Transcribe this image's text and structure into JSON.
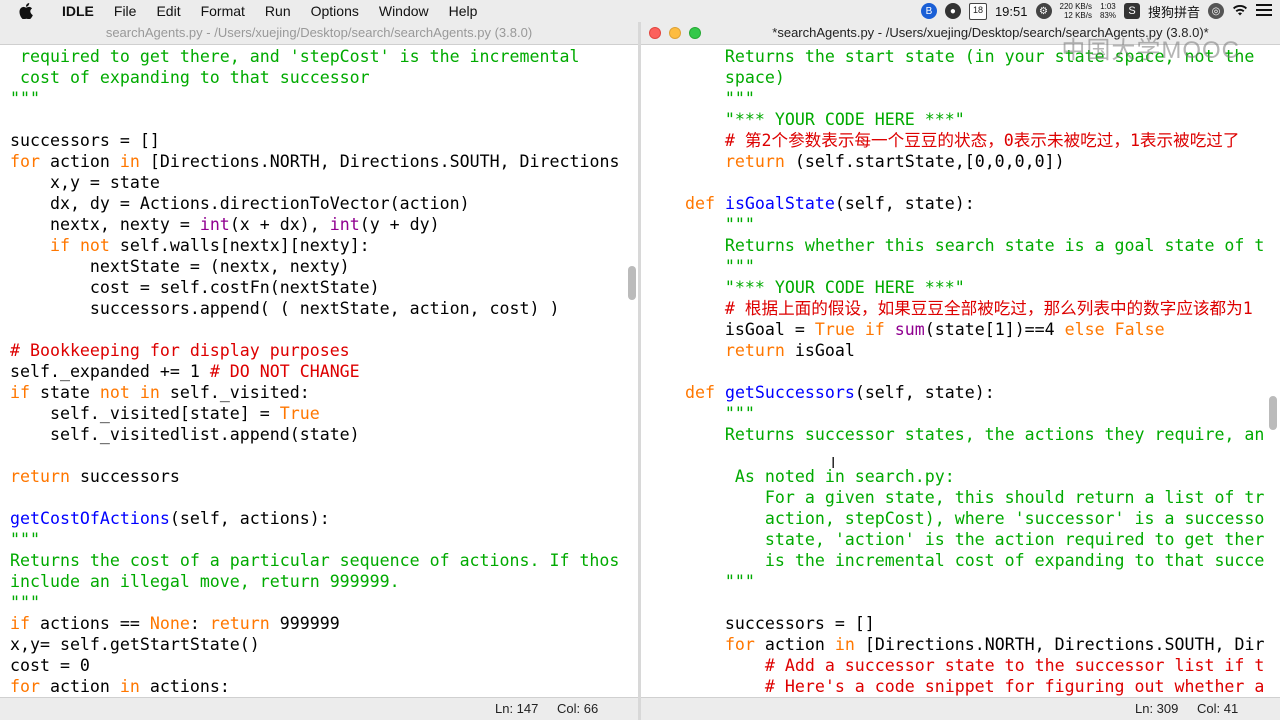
{
  "menubar": {
    "app_name": "IDLE",
    "items": [
      "File",
      "Edit",
      "Format",
      "Run",
      "Options",
      "Window",
      "Help"
    ],
    "clock": "19:51",
    "calendar_day": "18",
    "net_up": "220 KB/s",
    "net_down": "12 KB/s",
    "battery_time": "1:03",
    "battery_pct": "83%",
    "input_method": "搜狗拼音"
  },
  "left_window": {
    "title": "searchAgents.py - /Users/xuejing/Desktop/search/searchAgents.py (3.8.0)",
    "status_line": "Ln: 147",
    "status_col": "Col: 66",
    "lines": [
      {
        "segs": [
          {
            "t": " required to get there, and 'stepCost' is the incremental",
            "c": "str"
          }
        ]
      },
      {
        "segs": [
          {
            "t": " cost of expanding to that successor",
            "c": "str"
          }
        ]
      },
      {
        "segs": [
          {
            "t": "\"\"\"",
            "c": "str"
          }
        ]
      },
      {
        "segs": []
      },
      {
        "segs": [
          {
            "t": "successors = []",
            "c": ""
          }
        ]
      },
      {
        "segs": [
          {
            "t": "for",
            "c": "kw"
          },
          {
            "t": " action ",
            "c": ""
          },
          {
            "t": "in",
            "c": "kw"
          },
          {
            "t": " [Directions.NORTH, Directions.SOUTH, Directions",
            "c": ""
          }
        ]
      },
      {
        "segs": [
          {
            "t": "    x,y = state",
            "c": ""
          }
        ]
      },
      {
        "segs": [
          {
            "t": "    dx, dy = Actions.directionToVector(action)",
            "c": ""
          }
        ]
      },
      {
        "segs": [
          {
            "t": "    nextx, nexty = ",
            "c": ""
          },
          {
            "t": "int",
            "c": "blt"
          },
          {
            "t": "(x + dx), ",
            "c": ""
          },
          {
            "t": "int",
            "c": "blt"
          },
          {
            "t": "(y + dy)",
            "c": ""
          }
        ]
      },
      {
        "segs": [
          {
            "t": "    ",
            "c": ""
          },
          {
            "t": "if not",
            "c": "kw"
          },
          {
            "t": " self.walls[nextx][nexty]:",
            "c": ""
          }
        ]
      },
      {
        "segs": [
          {
            "t": "        nextState = (nextx, nexty)",
            "c": ""
          }
        ]
      },
      {
        "segs": [
          {
            "t": "        cost = self.costFn(nextState)",
            "c": ""
          }
        ]
      },
      {
        "segs": [
          {
            "t": "        successors.append( ( nextState, action, cost) )",
            "c": ""
          }
        ]
      },
      {
        "segs": []
      },
      {
        "segs": [
          {
            "t": "# Bookkeeping for display purposes",
            "c": "cmt"
          }
        ]
      },
      {
        "segs": [
          {
            "t": "self._expanded += 1 ",
            "c": ""
          },
          {
            "t": "# DO NOT CHANGE",
            "c": "cmt"
          }
        ]
      },
      {
        "segs": [
          {
            "t": "if",
            "c": "kw"
          },
          {
            "t": " state ",
            "c": ""
          },
          {
            "t": "not in",
            "c": "kw"
          },
          {
            "t": " self._visited:",
            "c": ""
          }
        ]
      },
      {
        "segs": [
          {
            "t": "    self._visited[state] = ",
            "c": ""
          },
          {
            "t": "True",
            "c": "kw"
          }
        ]
      },
      {
        "segs": [
          {
            "t": "    self._visitedlist.append(state)",
            "c": ""
          }
        ]
      },
      {
        "segs": []
      },
      {
        "segs": [
          {
            "t": "return",
            "c": "kw"
          },
          {
            "t": " successors",
            "c": ""
          }
        ]
      },
      {
        "segs": []
      },
      {
        "segs": [
          {
            "t": "getCostOfActions",
            "c": "def"
          },
          {
            "t": "(self, actions):",
            "c": ""
          }
        ]
      },
      {
        "segs": [
          {
            "t": "\"\"\"",
            "c": "str"
          }
        ]
      },
      {
        "segs": [
          {
            "t": "Returns the cost of a particular sequence of actions. If thos",
            "c": "str"
          }
        ]
      },
      {
        "segs": [
          {
            "t": "include an illegal move, return 999999.",
            "c": "str"
          }
        ]
      },
      {
        "segs": [
          {
            "t": "\"\"\"",
            "c": "str"
          }
        ]
      },
      {
        "segs": [
          {
            "t": "if",
            "c": "kw"
          },
          {
            "t": " actions == ",
            "c": ""
          },
          {
            "t": "None",
            "c": "kw"
          },
          {
            "t": ": ",
            "c": ""
          },
          {
            "t": "return",
            "c": "kw"
          },
          {
            "t": " 999999",
            "c": ""
          }
        ]
      },
      {
        "segs": [
          {
            "t": "x,y= self.getStartState()",
            "c": ""
          }
        ]
      },
      {
        "segs": [
          {
            "t": "cost = 0",
            "c": ""
          }
        ]
      },
      {
        "segs": [
          {
            "t": "for",
            "c": "kw"
          },
          {
            "t": " action ",
            "c": ""
          },
          {
            "t": "in",
            "c": "kw"
          },
          {
            "t": " actions:",
            "c": ""
          }
        ]
      }
    ]
  },
  "right_window": {
    "title": "*searchAgents.py - /Users/xuejing/Desktop/search/searchAgents.py (3.8.0)*",
    "status_line": "Ln: 309",
    "status_col": "Col: 41",
    "watermark": "中国大学MOOC",
    "lines": [
      {
        "segs": [
          {
            "t": "        Returns the start state (in your state space, not the",
            "c": "str"
          }
        ]
      },
      {
        "segs": [
          {
            "t": "        space)",
            "c": "str"
          }
        ]
      },
      {
        "segs": [
          {
            "t": "        \"\"\"",
            "c": "str"
          }
        ]
      },
      {
        "segs": [
          {
            "t": "        \"*** YOUR CODE HERE ***\"",
            "c": "str"
          }
        ]
      },
      {
        "segs": [
          {
            "t": "        # 第2个参数表示每一个豆豆的状态，0表示未被吃过，1表示被吃过了",
            "c": "cmt"
          }
        ]
      },
      {
        "segs": [
          {
            "t": "        ",
            "c": ""
          },
          {
            "t": "return",
            "c": "kw"
          },
          {
            "t": " (self.startState,[0,0,0,0])",
            "c": ""
          }
        ]
      },
      {
        "segs": []
      },
      {
        "segs": [
          {
            "t": "    ",
            "c": ""
          },
          {
            "t": "def",
            "c": "kw"
          },
          {
            "t": " ",
            "c": ""
          },
          {
            "t": "isGoalState",
            "c": "def"
          },
          {
            "t": "(self, state):",
            "c": ""
          }
        ]
      },
      {
        "segs": [
          {
            "t": "        \"\"\"",
            "c": "str"
          }
        ]
      },
      {
        "segs": [
          {
            "t": "        Returns whether this search state is a goal state of t",
            "c": "str"
          }
        ]
      },
      {
        "segs": [
          {
            "t": "        \"\"\"",
            "c": "str"
          }
        ]
      },
      {
        "segs": [
          {
            "t": "        \"*** YOUR CODE HERE ***\"",
            "c": "str"
          }
        ]
      },
      {
        "segs": [
          {
            "t": "        # 根据上面的假设，如果豆豆全部被吃过，那么列表中的数字应该都为1",
            "c": "cmt"
          }
        ]
      },
      {
        "segs": [
          {
            "t": "        isGoal = ",
            "c": ""
          },
          {
            "t": "True",
            "c": "kw"
          },
          {
            "t": " ",
            "c": ""
          },
          {
            "t": "if",
            "c": "kw"
          },
          {
            "t": " ",
            "c": ""
          },
          {
            "t": "sum",
            "c": "blt"
          },
          {
            "t": "(state[1])==4 ",
            "c": ""
          },
          {
            "t": "else",
            "c": "kw"
          },
          {
            "t": " ",
            "c": ""
          },
          {
            "t": "False",
            "c": "kw"
          }
        ]
      },
      {
        "segs": [
          {
            "t": "        ",
            "c": ""
          },
          {
            "t": "return",
            "c": "kw"
          },
          {
            "t": " isGoal",
            "c": ""
          }
        ]
      },
      {
        "segs": []
      },
      {
        "segs": [
          {
            "t": "    ",
            "c": ""
          },
          {
            "t": "def",
            "c": "kw"
          },
          {
            "t": " ",
            "c": ""
          },
          {
            "t": "getSuccessors",
            "c": "def"
          },
          {
            "t": "(self, state):",
            "c": ""
          }
        ]
      },
      {
        "segs": [
          {
            "t": "        \"\"\"",
            "c": "str"
          }
        ]
      },
      {
        "segs": [
          {
            "t": "        Returns successor states, the actions they require, an",
            "c": "str"
          }
        ]
      },
      {
        "segs": []
      },
      {
        "segs": [
          {
            "t": "         As noted in search.py:",
            "c": "str"
          }
        ]
      },
      {
        "segs": [
          {
            "t": "            For a given state, this should return a list of tr",
            "c": "str"
          }
        ]
      },
      {
        "segs": [
          {
            "t": "            action, stepCost), where 'successor' is a successo",
            "c": "str"
          }
        ]
      },
      {
        "segs": [
          {
            "t": "            state, 'action' is the action required to get ther",
            "c": "str"
          }
        ]
      },
      {
        "segs": [
          {
            "t": "            is the incremental cost of expanding to that succe",
            "c": "str"
          }
        ]
      },
      {
        "segs": [
          {
            "t": "        \"\"\"",
            "c": "str"
          }
        ]
      },
      {
        "segs": []
      },
      {
        "segs": [
          {
            "t": "        successors = []",
            "c": ""
          }
        ]
      },
      {
        "segs": [
          {
            "t": "        ",
            "c": ""
          },
          {
            "t": "for",
            "c": "kw"
          },
          {
            "t": " action ",
            "c": ""
          },
          {
            "t": "in",
            "c": "kw"
          },
          {
            "t": " [Directions.NORTH, Directions.SOUTH, Dir",
            "c": ""
          }
        ]
      },
      {
        "segs": [
          {
            "t": "            # Add a successor state to the successor list if t",
            "c": "cmt"
          }
        ]
      },
      {
        "segs": [
          {
            "t": "            # Here's a code snippet for figuring out whether a",
            "c": "cmt"
          }
        ]
      }
    ]
  }
}
